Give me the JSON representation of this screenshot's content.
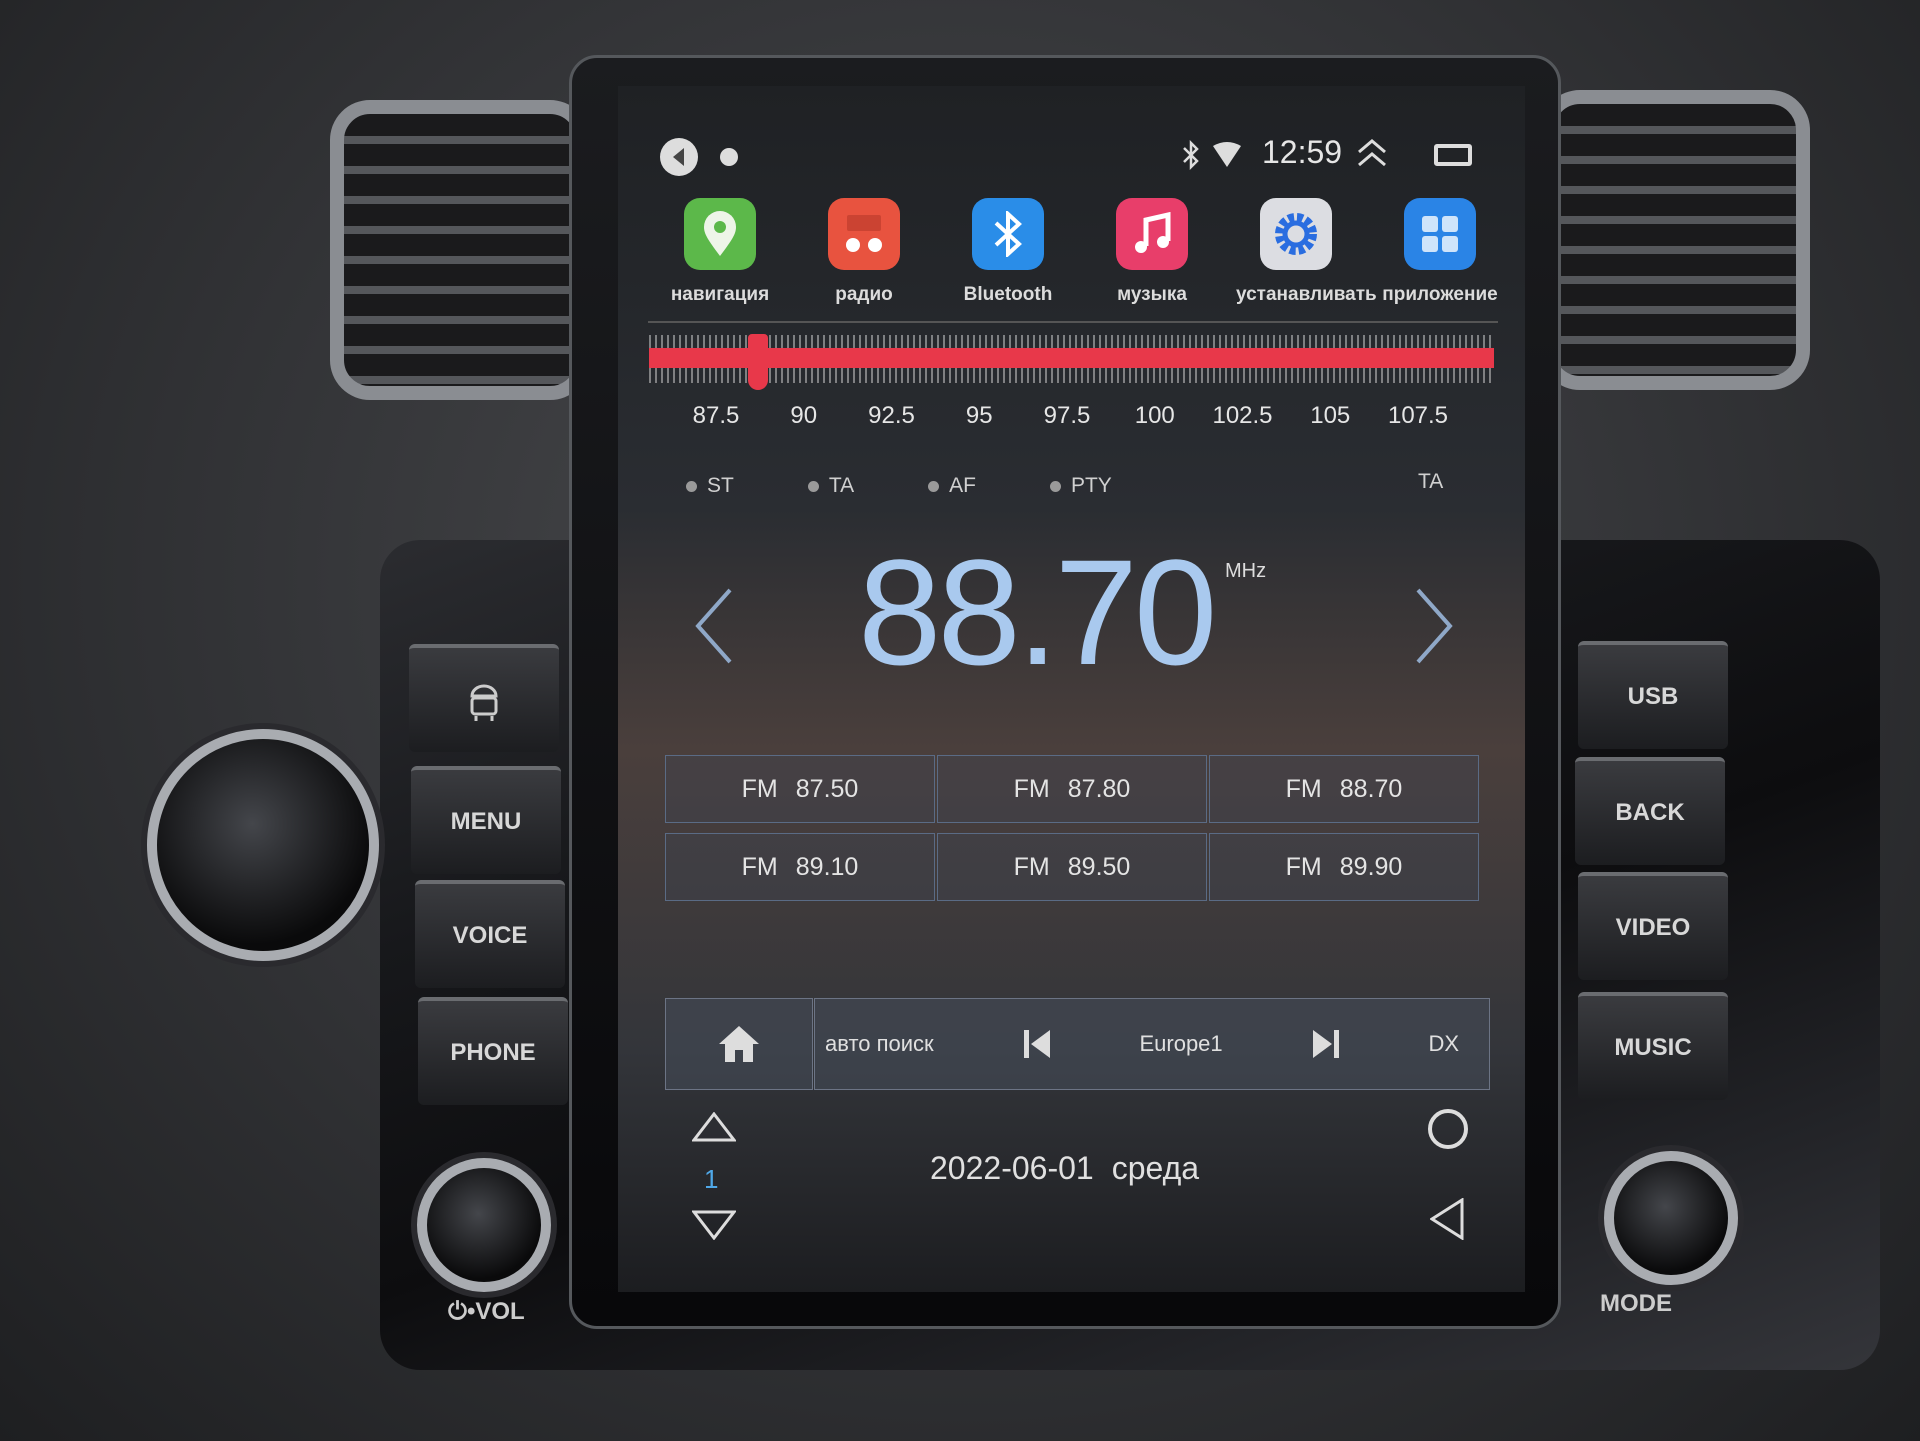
{
  "status_bar": {
    "time": "12:59",
    "icons": [
      "volume-icon",
      "dot-icon",
      "bluetooth-icon",
      "wifi-icon",
      "chevron-up-double-icon",
      "recent-apps-icon"
    ]
  },
  "apps": [
    {
      "label": "навигация",
      "icon": "map-pin-icon",
      "color": "#5cb84a"
    },
    {
      "label": "радио",
      "icon": "radio-icon",
      "color": "#e8533f"
    },
    {
      "label": "Bluetooth",
      "icon": "bluetooth-icon",
      "color": "#2a8de8"
    },
    {
      "label": "музыка",
      "icon": "music-note-icon",
      "color": "#e83e6a"
    },
    {
      "label": "устанавливать",
      "icon": "gear-icon",
      "color": "#dcdde2"
    },
    {
      "label": "приложение",
      "icon": "grid-icon",
      "color": "#2a84e6"
    }
  ],
  "tuner": {
    "min": 87.5,
    "max": 108,
    "value": 88.7,
    "accent": "#e8384a",
    "ticks": [
      "87.5",
      "90",
      "92.5",
      "95",
      "97.5",
      "100",
      "102.5",
      "105",
      "107.5"
    ]
  },
  "indicators": [
    "ST",
    "TA",
    "AF",
    "PTY"
  ],
  "ta_label": "TA",
  "frequency": {
    "value": "88.70",
    "unit": "MHz"
  },
  "presets": [
    {
      "band": "FM",
      "freq": "87.50"
    },
    {
      "band": "FM",
      "freq": "87.80"
    },
    {
      "band": "FM",
      "freq": "88.70"
    },
    {
      "band": "FM",
      "freq": "89.10"
    },
    {
      "band": "FM",
      "freq": "89.50"
    },
    {
      "band": "FM",
      "freq": "89.90"
    }
  ],
  "bottom_bar": {
    "auto_search": "авто поиск",
    "region": "Europe1",
    "dx": "DX"
  },
  "nav": {
    "page": "1",
    "date": "2022-06-01",
    "weekday": "среда"
  },
  "hardware": {
    "left": [
      "MENU",
      "VOICE",
      "PHONE"
    ],
    "vol": "⏻•VOL",
    "right": [
      "USB",
      "BACK",
      "VIDEO",
      "MUSIC"
    ],
    "mode": "MODE"
  }
}
